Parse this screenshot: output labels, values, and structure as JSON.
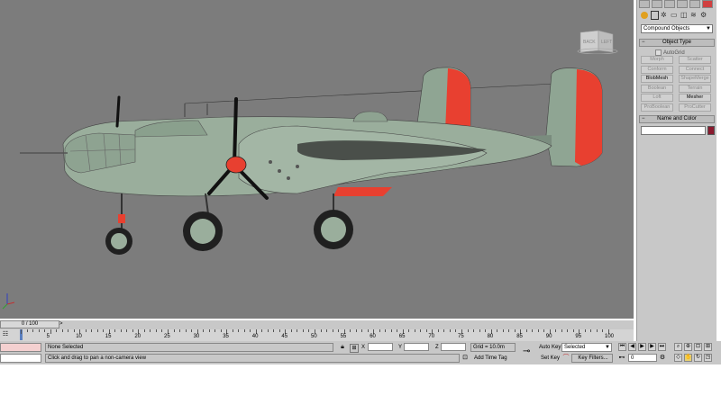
{
  "viewport": {
    "viewcube": {
      "front_label": "BACK",
      "side_label": "LEFT"
    },
    "colors": {
      "background": "#7c7c7c",
      "airframe": "#9aae9c",
      "accent": "#e84030",
      "prop": "#111111",
      "tire": "#202020"
    }
  },
  "command_panel": {
    "tabs": [
      "create-icon",
      "modify-icon",
      "hierarchy-icon",
      "motion-icon",
      "display-icon",
      "utilities-icon"
    ],
    "categories": [
      "geometry-icon",
      "shapes-icon",
      "lights-icon",
      "cameras-icon",
      "helpers-icon",
      "spacewarps-icon",
      "systems-icon"
    ],
    "dropdown_value": "Compound Objects",
    "object_type": {
      "title": "Object Type",
      "autogrid_label": "AutoGrid",
      "buttons": [
        {
          "label": "Morph",
          "enabled": false
        },
        {
          "label": "Scatter",
          "enabled": false
        },
        {
          "label": "Conform",
          "enabled": false
        },
        {
          "label": "Connect",
          "enabled": false
        },
        {
          "label": "BlobMesh",
          "enabled": true
        },
        {
          "label": "ShapeMerge",
          "enabled": false
        },
        {
          "label": "Boolean",
          "enabled": false
        },
        {
          "label": "Terrain",
          "enabled": false
        },
        {
          "label": "Loft",
          "enabled": false
        },
        {
          "label": "Mesher",
          "enabled": true
        },
        {
          "label": "ProBoolean",
          "enabled": false
        },
        {
          "label": "ProCutter",
          "enabled": false
        }
      ]
    },
    "name_and_color": {
      "title": "Name and Color",
      "name_value": "",
      "color": "#8a1a2e"
    }
  },
  "time_slider": {
    "label": "0 / 100",
    "next_symbol": ">"
  },
  "trackbar": {
    "ticks": [
      "5",
      "10",
      "15",
      "20",
      "25",
      "30",
      "35",
      "40",
      "45",
      "50",
      "55",
      "60",
      "65",
      "70",
      "75",
      "80",
      "85",
      "90",
      "95",
      "100"
    ]
  },
  "status": {
    "selection": "None Selected",
    "prompt": "Click and drag to pan a non-camera view",
    "x_label": "X",
    "y_label": "Y",
    "z_label": "Z",
    "grid": "Grid = 10.0m",
    "add_time_tag": "Add Time Tag",
    "auto_key": "Auto Key",
    "set_key": "Set Key",
    "key_mode_value": "Selected",
    "key_filters": "Key Filters...",
    "frame_value": "0"
  }
}
